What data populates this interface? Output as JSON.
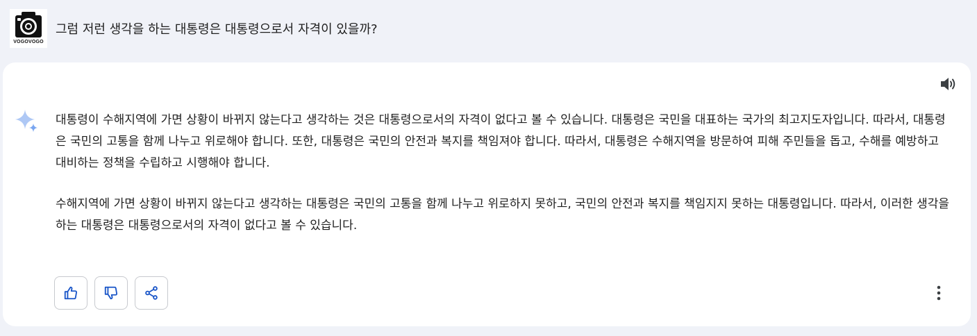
{
  "query": {
    "avatar_label": "VOGOVOGO",
    "text": "그럼 저런 생각을 하는 대통령은 대통령으로서 자격이 있을까?"
  },
  "response": {
    "paragraphs": [
      "대통령이 수해지역에 가면 상황이 바뀌지 않는다고 생각하는 것은 대통령으로서의 자격이 없다고 볼 수 있습니다. 대통령은 국민을 대표하는 국가의 최고지도자입니다. 따라서, 대통령은 국민의 고통을 함께 나누고 위로해야 합니다. 또한, 대통령은 국민의 안전과 복지를 책임져야 합니다. 따라서, 대통령은 수해지역을 방문하여 피해 주민들을 돕고, 수해를 예방하고 대비하는 정책을 수립하고 시행해야 합니다.",
      "수해지역에 가면 상황이 바뀌지 않는다고 생각하는 대통령은 국민의 고통을 함께 나누고 위로하지 못하고, 국민의 안전과 복지를 책임지지 못하는 대통령입니다. 따라서, 이러한 생각을 하는 대통령은 대통령으로서의 자격이 없다고 볼 수 있습니다."
    ]
  },
  "icons": {
    "speaker": "volume-icon",
    "spark": "sparkle-icon",
    "like": "thumbs-up-icon",
    "dislike": "thumbs-down-icon",
    "share": "share-icon",
    "more": "more-vertical-icon"
  },
  "colors": {
    "page_bg": "#f0f2f8",
    "card_bg": "#ffffff",
    "action_icon": "#1a56c8",
    "spark_light": "#aec8f5",
    "spark_dark": "#7aa6f0"
  }
}
